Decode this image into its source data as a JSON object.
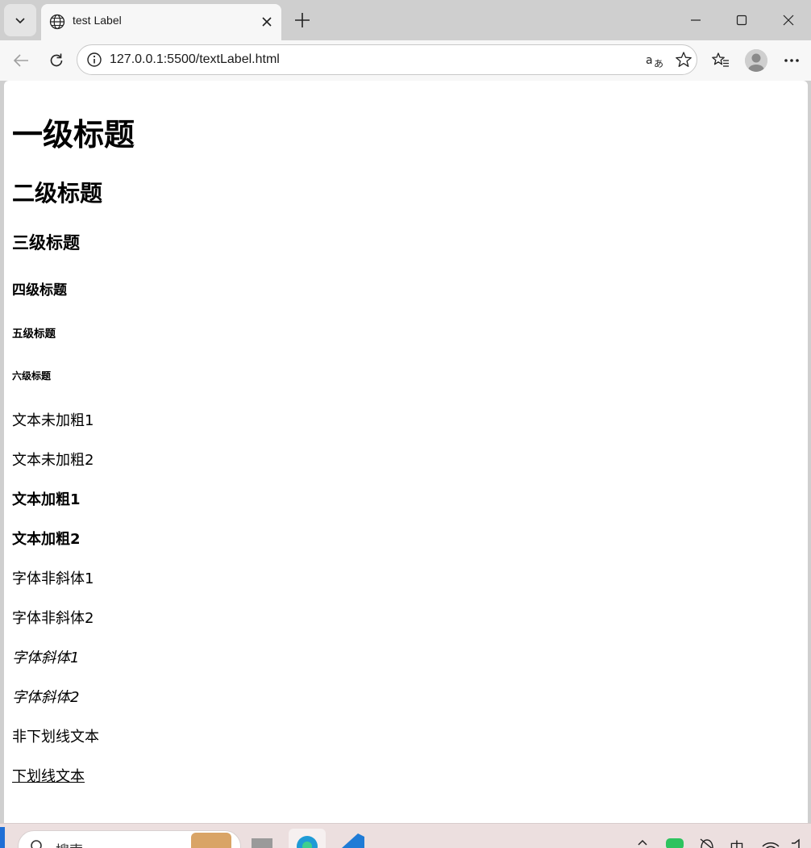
{
  "browser": {
    "tab_title": "test Label",
    "url": "127.0.0.1:5500/textLabel.html",
    "icons": {
      "tab_menu": "chevron-down-icon",
      "favicon": "globe-icon",
      "tab_close": "close-icon",
      "new_tab": "plus-icon",
      "minimize": "minimize-icon",
      "maximize": "maximize-icon",
      "close_window": "close-icon",
      "back": "arrow-left-icon",
      "refresh": "refresh-icon",
      "site_info": "info-icon",
      "translate": "translate-icon",
      "favorite": "star-icon",
      "favorites_list": "favorites-icon",
      "profile": "avatar-icon",
      "more": "more-icon"
    }
  },
  "page": {
    "h1": "一级标题",
    "h2": "二级标题",
    "h3": "三级标题",
    "h4": "四级标题",
    "h5": "五级标题",
    "h6": "六级标题",
    "paragraphs": [
      "文本未加粗1",
      "文本未加粗2",
      "文本加粗1",
      "文本加粗2",
      "字体非斜体1",
      "字体非斜体2",
      "字体斜体1",
      "字体斜体2",
      "非下划线文本",
      "下划线文本"
    ]
  },
  "taskbar": {
    "search_text": "搜索",
    "ime_indicator": "中"
  },
  "colors": {
    "tabstrip_bg": "#cfcfcf",
    "toolbar_bg": "#f7f7f7",
    "page_bg": "#ffffff",
    "taskbar_bg": "#ecdfdf"
  }
}
